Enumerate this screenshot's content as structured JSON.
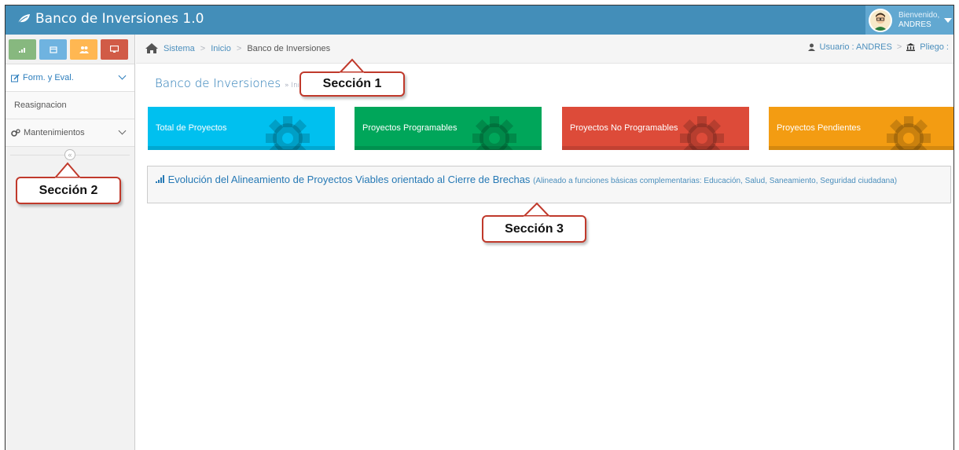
{
  "navbar": {
    "title": "Banco de Inversiones 1.0",
    "logo_icon": "leaf-icon",
    "welcome_label": "Bienvenido,",
    "user_name": "ANDRES"
  },
  "sidebar": {
    "shortcuts": [
      {
        "icon": "bar-chart-icon",
        "color": "#87b87f"
      },
      {
        "icon": "calendar-icon",
        "color": "#6fb3e0"
      },
      {
        "icon": "users-icon",
        "color": "#ffb752"
      },
      {
        "icon": "desktop-icon",
        "color": "#d15b47"
      }
    ],
    "items": [
      {
        "label": "Form. y Eval.",
        "icon": "edit-icon"
      },
      {
        "label": "Reasignacion"
      },
      {
        "label": "Mantenimientos",
        "icon": "cogs-icon"
      }
    ],
    "collapse_glyph": "«"
  },
  "breadcrumbs": {
    "items": [
      "Sistema",
      "Inicio",
      "Banco de Inversiones"
    ],
    "separator": ">",
    "user_label": "Usuario : ANDRES",
    "pliego_label": "Pliego :"
  },
  "page_header": {
    "title": "Banco de Inversiones",
    "subtitle": "» Inicio"
  },
  "tiles": [
    {
      "label": "Total de Proyectos",
      "color": "#00c0ef"
    },
    {
      "label": "Proyectos Programables",
      "color": "#00a65a"
    },
    {
      "label": "Proyectos No Programables",
      "color": "#dd4b39"
    },
    {
      "label": "Proyectos Pendientes",
      "color": "#f39c12"
    }
  ],
  "widget": {
    "title": "Evolución del Alineamiento de Proyectos Viables orientado al Cierre de Brechas",
    "subtitle": "(Alineado a funciones básicas complementarias: Educación, Salud, Saneamiento, Seguridad ciudadana)"
  },
  "callouts": [
    "Sección 1",
    "Sección 2",
    "Sección 3"
  ]
}
